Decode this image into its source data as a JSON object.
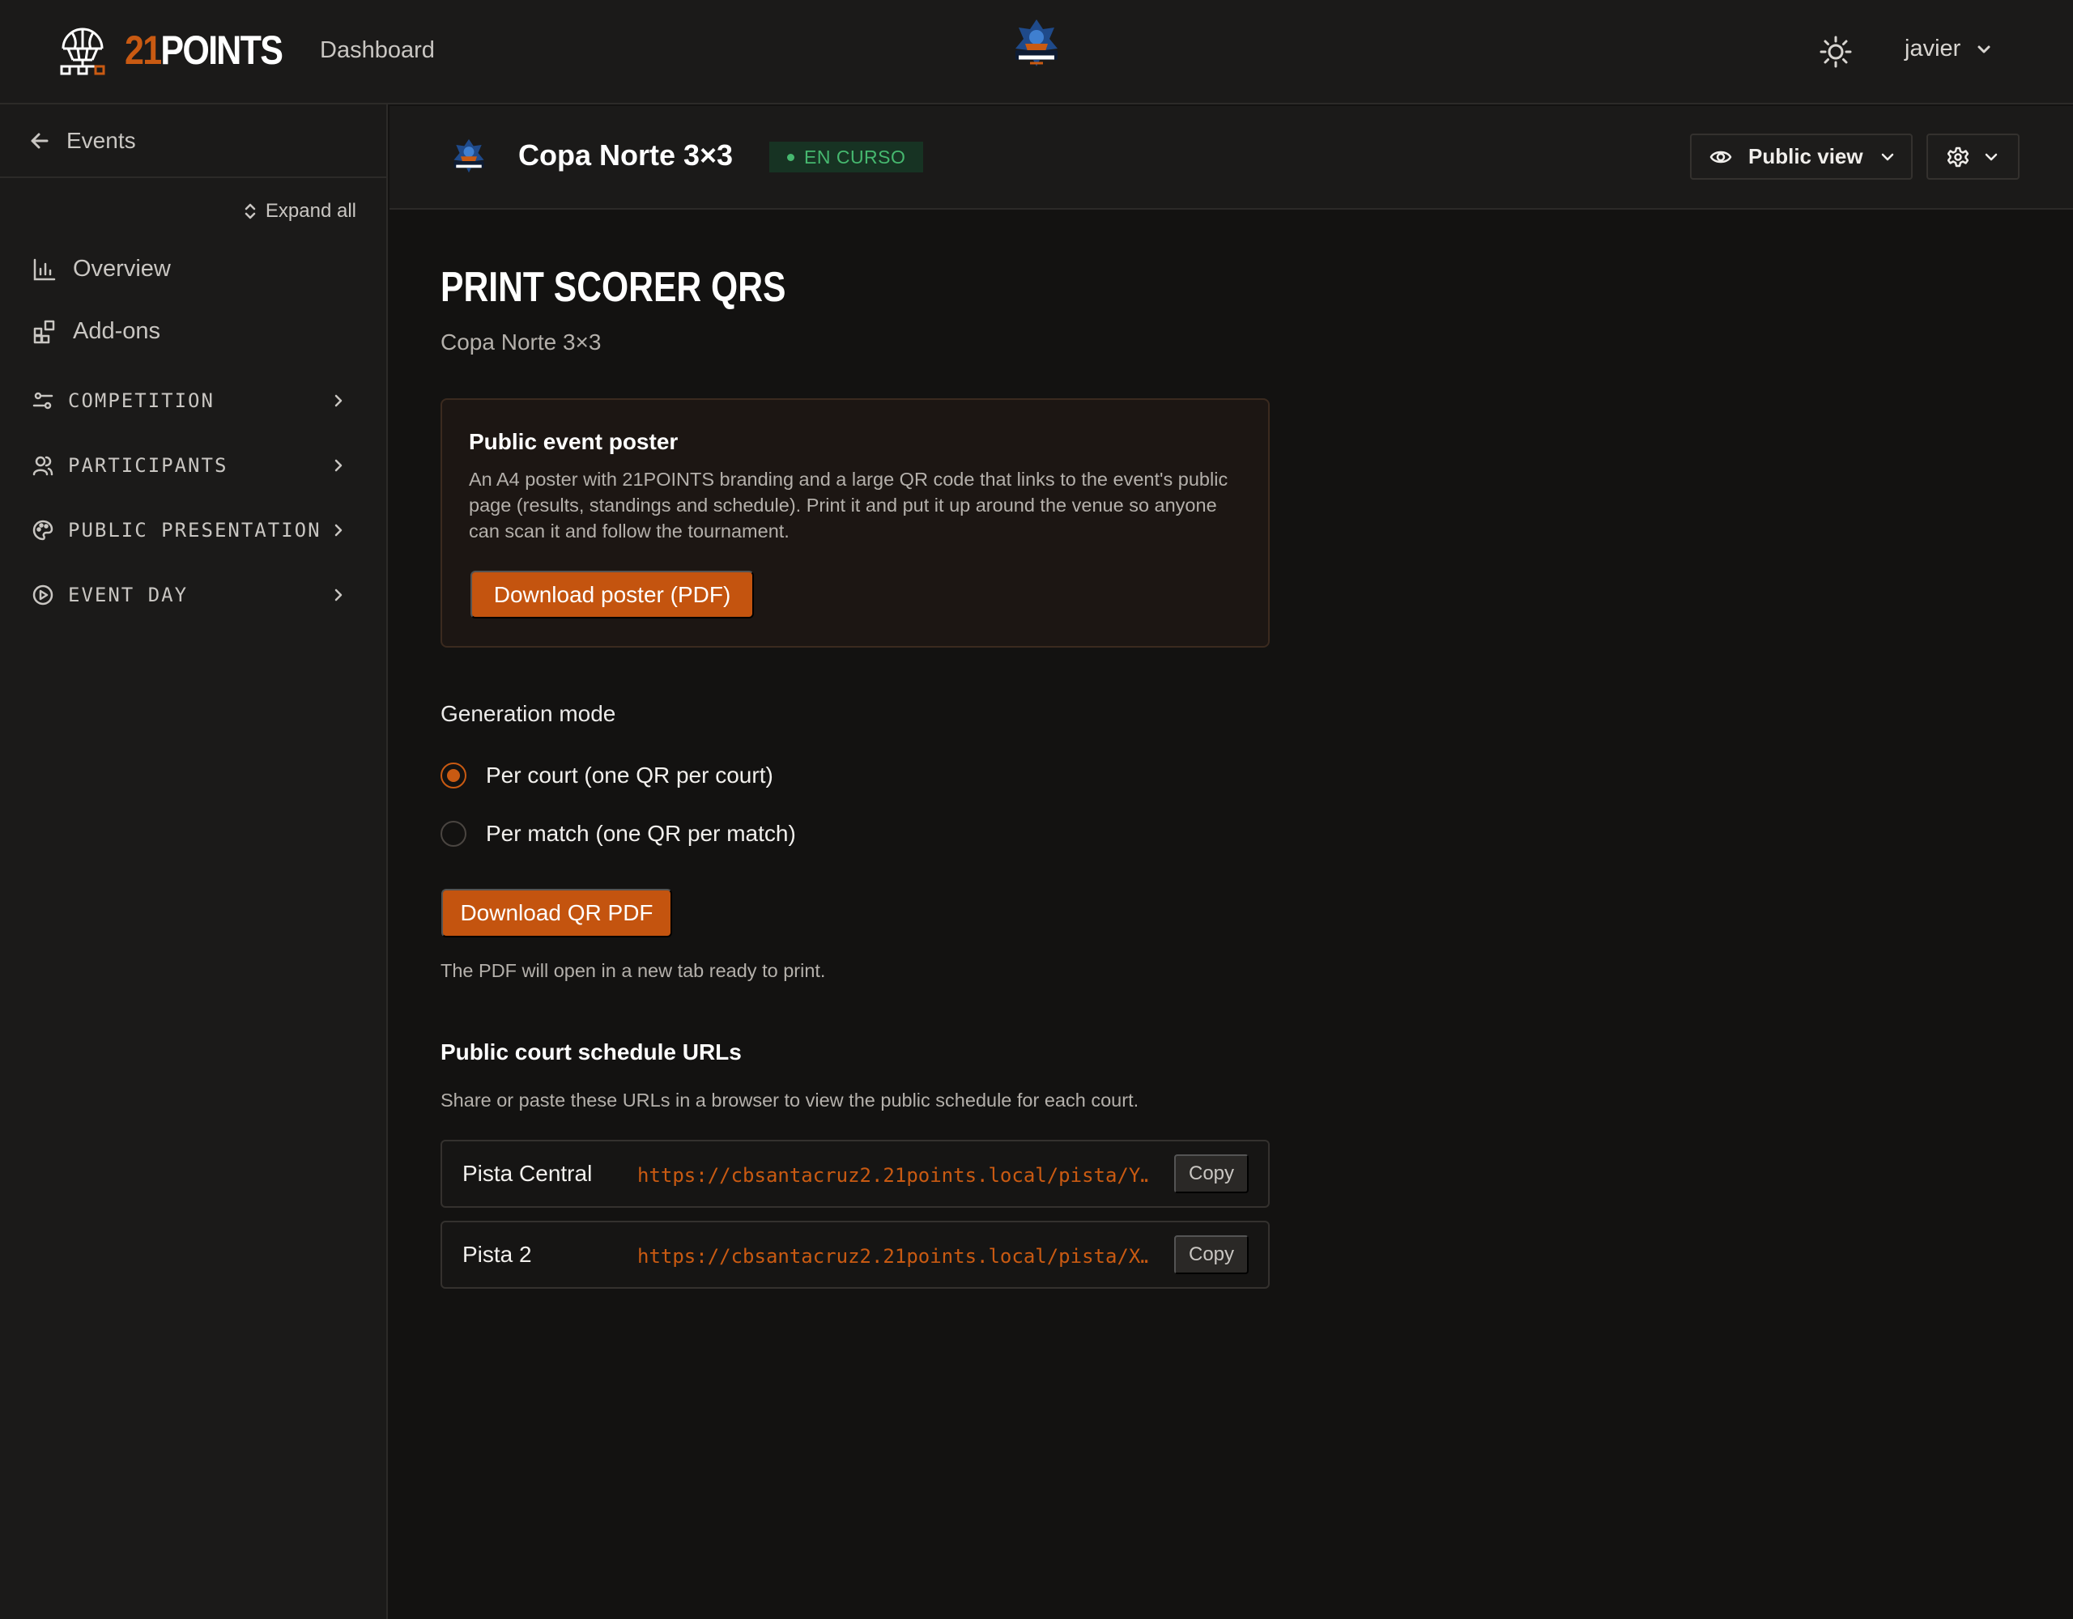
{
  "topbar": {
    "brand_accent": "21",
    "brand_rest": "POINTS",
    "nav_dashboard": "Dashboard",
    "user_name": "javier",
    "icons": [
      "basketball-hoop-icon",
      "sun-icon",
      "chevron-down-icon"
    ]
  },
  "sidebar": {
    "back_label": "Events",
    "expand_all": "Expand all",
    "items": [
      {
        "label": "Overview",
        "icon": "bar-chart-icon"
      },
      {
        "label": "Add-ons",
        "icon": "grid-plus-icon"
      }
    ],
    "sections": [
      {
        "label": "COMPETITION",
        "icon": "sliders-icon"
      },
      {
        "label": "PARTICIPANTS",
        "icon": "users-icon"
      },
      {
        "label": "PUBLIC PRESENTATION",
        "icon": "palette-icon"
      },
      {
        "label": "EVENT DAY",
        "icon": "play-circle-icon"
      }
    ]
  },
  "event": {
    "title": "Copa Norte 3×3",
    "status": "EN CURSO",
    "public_view": "Public view"
  },
  "main": {
    "title": "PRINT SCORER QRS",
    "subtitle": "Copa Norte 3×3",
    "poster": {
      "title": "Public event poster",
      "description": "An A4 poster with 21POINTS branding and a large QR code that links to the event's public page (results, standings and schedule). Print it and put it up around the venue so anyone can scan it and follow the tournament.",
      "button": "Download poster (PDF)"
    },
    "generation_mode": {
      "label": "Generation mode",
      "options": [
        {
          "label": "Per court (one QR per court)",
          "selected": true
        },
        {
          "label": "Per match (one QR per match)",
          "selected": false
        }
      ]
    },
    "qr_button": "Download QR PDF",
    "pdf_note": "The PDF will open in a new tab ready to print.",
    "urls": {
      "title": "Public court schedule URLs",
      "description": "Share or paste these URLs in a browser to view the public schedule for each court.",
      "copy_label": "Copy",
      "rows": [
        {
          "court": "Pista Central",
          "url": "https://cbsantacruz2.21points.local/pista/Y…"
        },
        {
          "court": "Pista 2",
          "url": "https://cbsantacruz2.21points.local/pista/X…"
        }
      ]
    }
  },
  "colors": {
    "accent": "#c95a12",
    "success": "#46b86f",
    "background": "#131211",
    "panel": "#1b1a19"
  }
}
